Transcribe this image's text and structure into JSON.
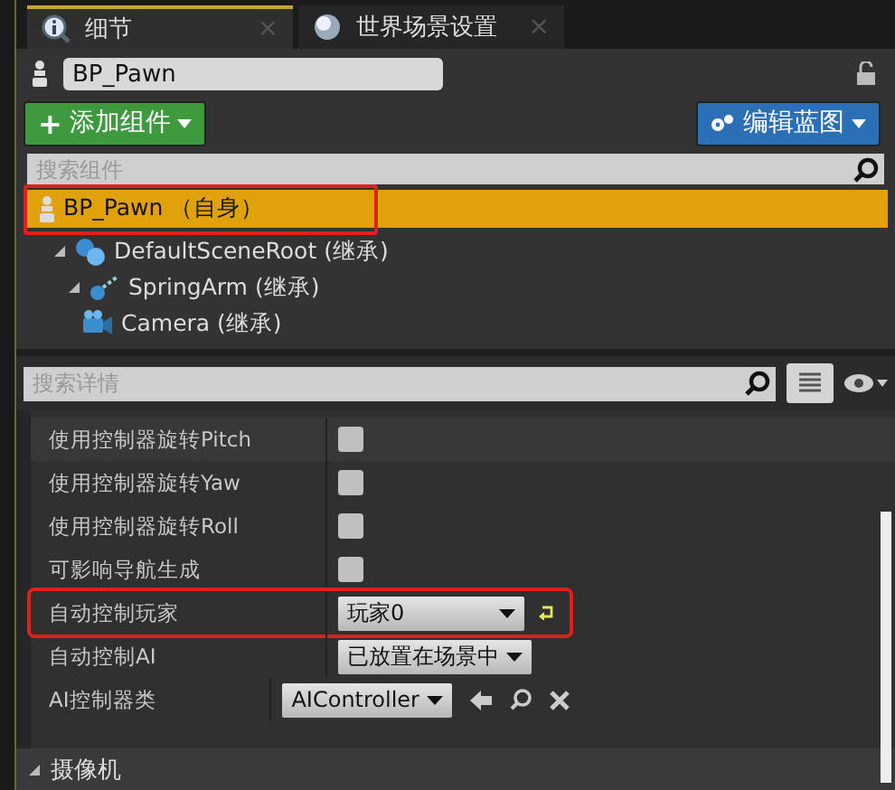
{
  "tabs": [
    {
      "label": "细节",
      "close": "×",
      "selected": true
    },
    {
      "label": "世界场景设置",
      "close": "×",
      "selected": false
    }
  ],
  "actor_name": {
    "value": "BP_Pawn"
  },
  "add_component_button": {
    "prefix": "+",
    "label": "添加组件"
  },
  "edit_blueprint_button": {
    "label": "编辑蓝图"
  },
  "component_search": {
    "placeholder": "搜索组件"
  },
  "components": [
    {
      "name": "BP_Pawn",
      "suffix": "（自身）",
      "selected": true,
      "highlighted": true,
      "children": [
        {
          "name": "DefaultSceneRoot",
          "suffix": "(继承)",
          "selected": false,
          "highlighted": false,
          "expanded": true,
          "children": [
            {
              "name": "SpringArm",
              "suffix": "(继承)",
              "selected": false,
              "highlighted": false,
              "expanded": true,
              "children": [
                {
                  "name": "Camera",
                  "suffix": "(继承)",
                  "selected": false,
                  "highlighted": false
                }
              ]
            }
          ]
        }
      ]
    }
  ],
  "details_search": {
    "placeholder": "搜索详情"
  },
  "properties": [
    {
      "label": "使用控制器旋转Pitch",
      "kind": "checkbox",
      "checked": false,
      "highlighted": false
    },
    {
      "label": "使用控制器旋转Yaw",
      "kind": "checkbox",
      "checked": false,
      "highlighted": false
    },
    {
      "label": "使用控制器旋转Roll",
      "kind": "checkbox",
      "checked": false,
      "highlighted": false
    },
    {
      "label": "可影响导航生成",
      "kind": "checkbox",
      "checked": false,
      "highlighted": false
    },
    {
      "label": "自动控制玩家",
      "kind": "dropdown",
      "value": "玩家0",
      "resettable": true,
      "highlighted": true
    },
    {
      "label": "自动控制AI",
      "kind": "dropdown",
      "value": "已放置在场景中",
      "resettable": false,
      "highlighted": false
    },
    {
      "label": "AI控制器类",
      "kind": "class",
      "value": "AIController",
      "highlighted": false
    }
  ],
  "category": {
    "label": "摄像机",
    "expanded": true
  }
}
